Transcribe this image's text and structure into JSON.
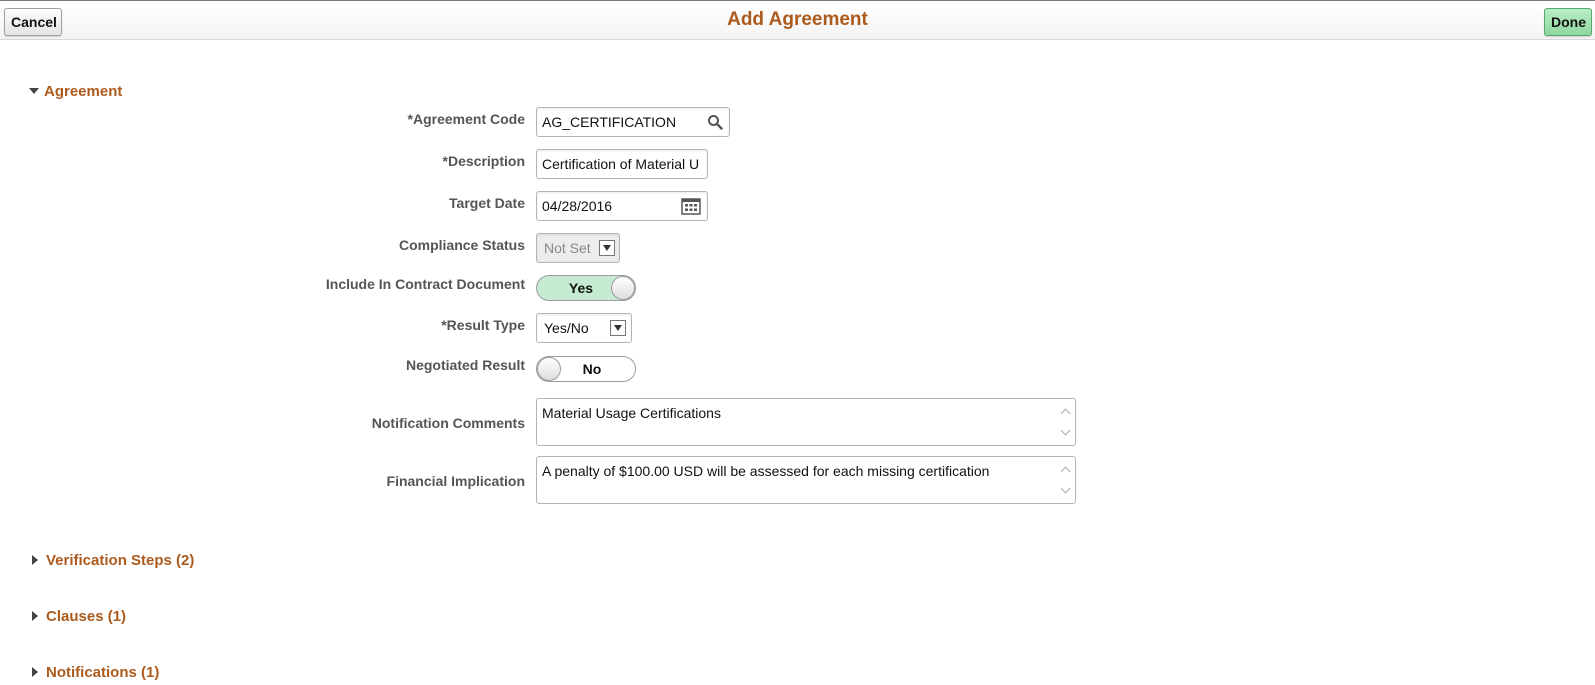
{
  "header": {
    "title": "Add Agreement",
    "cancel_label": "Cancel",
    "done_label": "Done"
  },
  "agreement_section": {
    "title": "Agreement",
    "expanded": true,
    "fields": {
      "agreement_code": {
        "label": "*Agreement Code",
        "value": "AG_CERTIFICATION",
        "icon": "search-icon"
      },
      "description": {
        "label": "*Description",
        "value": "Certification of Material U"
      },
      "target_date": {
        "label": "Target Date",
        "value": "04/28/2016",
        "icon": "calendar-icon"
      },
      "compliance_status": {
        "label": "Compliance Status",
        "value": "Not Set",
        "disabled": true
      },
      "include_in_contract": {
        "label": "Include In Contract Document",
        "value": "Yes",
        "on": true
      },
      "result_type": {
        "label": "*Result Type",
        "value": "Yes/No"
      },
      "negotiated_result": {
        "label": "Negotiated Result",
        "value": "No",
        "on": false
      },
      "notification_comments": {
        "label": "Notification Comments",
        "value": "Material Usage Certifications"
      },
      "financial_implication": {
        "label": "Financial Implication",
        "value": "A penalty of $100.00 USD will be assessed for each missing certification"
      }
    }
  },
  "collapsed_sections": [
    {
      "title": "Verification Steps (2)"
    },
    {
      "title": "Clauses (1)"
    },
    {
      "title": "Notifications (1)"
    }
  ],
  "colors": {
    "accent": "#ad5b1d",
    "toggle_on": "#c6ebd2",
    "done_button": "#a3e2b1"
  }
}
